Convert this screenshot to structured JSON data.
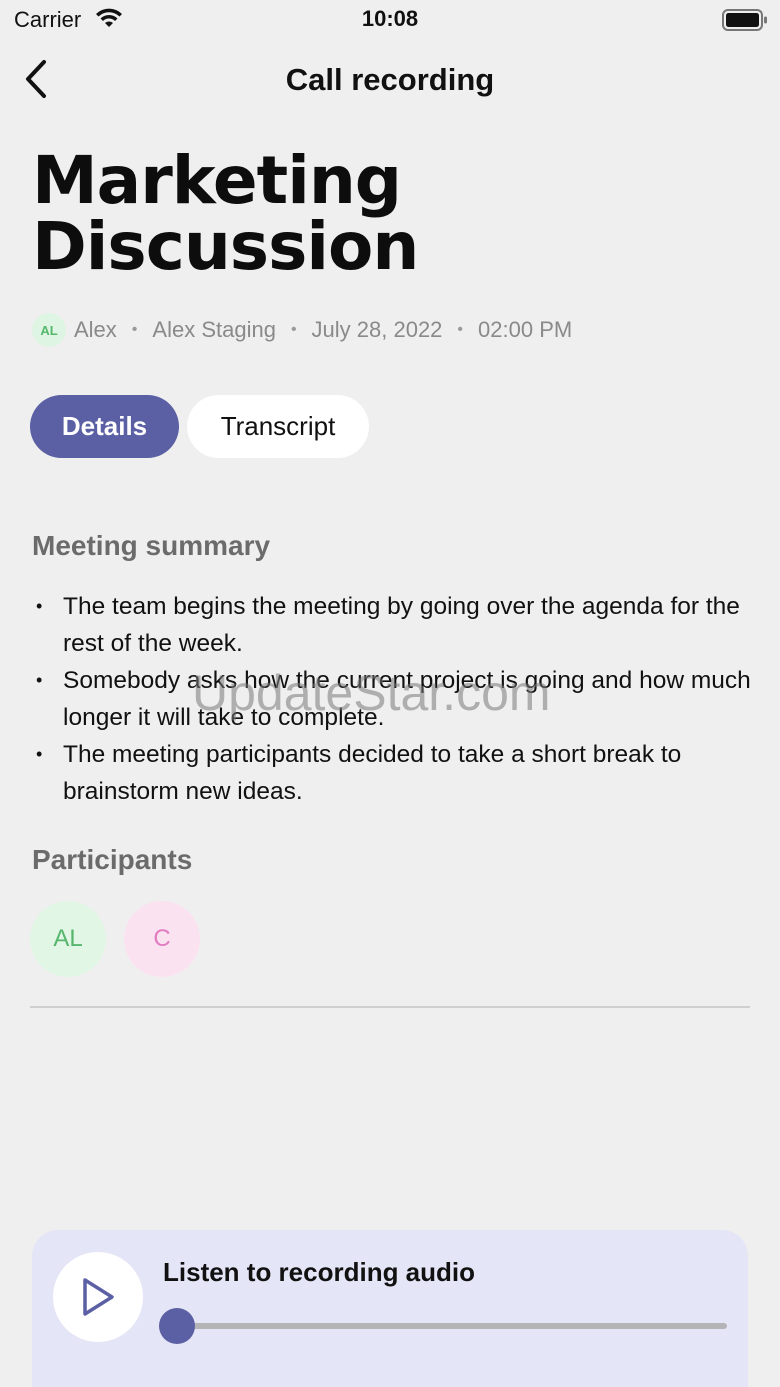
{
  "status_bar": {
    "carrier": "Carrier",
    "time": "10:08",
    "icons": [
      "wifi-icon",
      "battery-icon"
    ]
  },
  "nav": {
    "back_icon": "chevron-left-icon",
    "title": "Call recording"
  },
  "recording": {
    "title": "Marketing Discussion",
    "owner_initials": "AL",
    "owner": "Alex",
    "workspace": "Alex Staging",
    "date": "July 28, 2022",
    "time": "02:00 PM"
  },
  "tabs": [
    {
      "label": "Details",
      "active": true
    },
    {
      "label": "Transcript",
      "active": false
    }
  ],
  "summary": {
    "heading": "Meeting summary",
    "items": [
      "The team begins the meeting by going over the agenda for the rest of the week.",
      "Somebody asks how the current project is going and how much longer it will take to complete.",
      "The meeting participants decided to take a short break to brainstorm new ideas."
    ]
  },
  "watermark": "UpdateStar.com",
  "participants": {
    "heading": "Participants",
    "list": [
      {
        "initials": "AL",
        "color": "#57b66d",
        "bg": "#e1f6e4"
      },
      {
        "initials": "C",
        "color": "#e07cc0",
        "bg": "#fbe2f0"
      }
    ]
  },
  "player": {
    "label": "Listen to recording audio",
    "progress": 0,
    "play_icon": "play-icon"
  },
  "colors": {
    "accent": "#5b5fa3",
    "background": "#efefef",
    "player_bg": "#e4e5f6"
  }
}
